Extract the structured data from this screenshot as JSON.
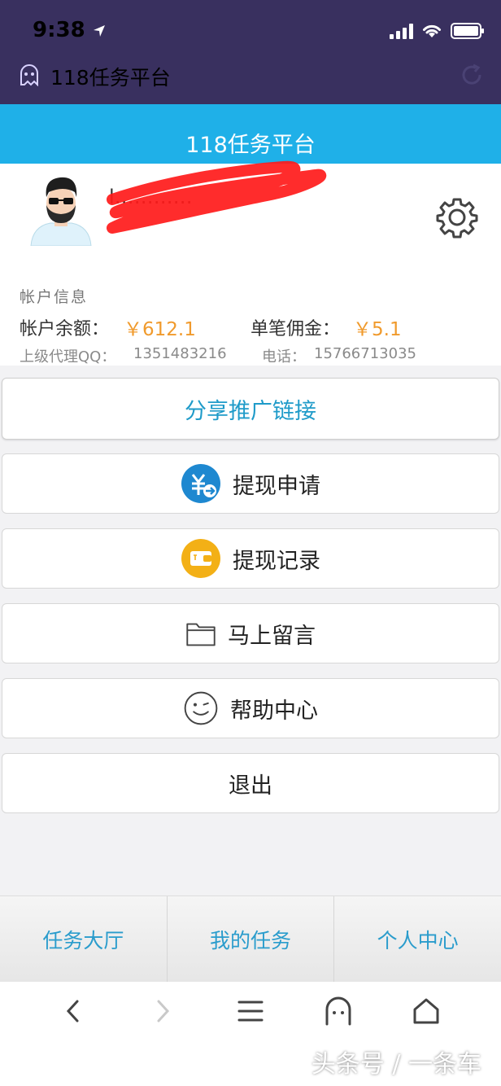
{
  "status": {
    "time": "9:38"
  },
  "browser": {
    "title": "118任务平台"
  },
  "header": {
    "title": "118任务平台"
  },
  "profile": {
    "username": "l…………"
  },
  "account": {
    "heading": "帐户信息",
    "balance_label": "帐户余额：",
    "balance_value": "￥612.1",
    "commission_label": "单笔佣金：",
    "commission_value": "￥5.1",
    "agent_qq_label": "上级代理QQ：",
    "agent_qq": "1351483216",
    "phone_label": "电话：",
    "phone": "15766713035"
  },
  "menu": {
    "share": "分享推广链接",
    "withdraw_apply": "提现申请",
    "withdraw_record": "提现记录",
    "message": "马上留言",
    "help": "帮助中心",
    "logout": "退出"
  },
  "tabs": [
    "任务大厅",
    "我的任务",
    "个人中心"
  ],
  "watermark": "头条号 / 一条车",
  "colors": {
    "header_bg": "#39305f",
    "band": "#1fb0e8",
    "accent_text": "#2a9ccc",
    "money": "#f09a2c"
  },
  "icons": [
    "location-arrow-icon",
    "signal-icon",
    "wifi-icon",
    "battery-icon",
    "ghost-icon",
    "refresh-icon",
    "gear-icon",
    "yuan-transfer-icon",
    "wallet-icon",
    "folder-icon",
    "wink-face-icon",
    "back-icon",
    "forward-icon",
    "menu-icon",
    "home-icon"
  ]
}
